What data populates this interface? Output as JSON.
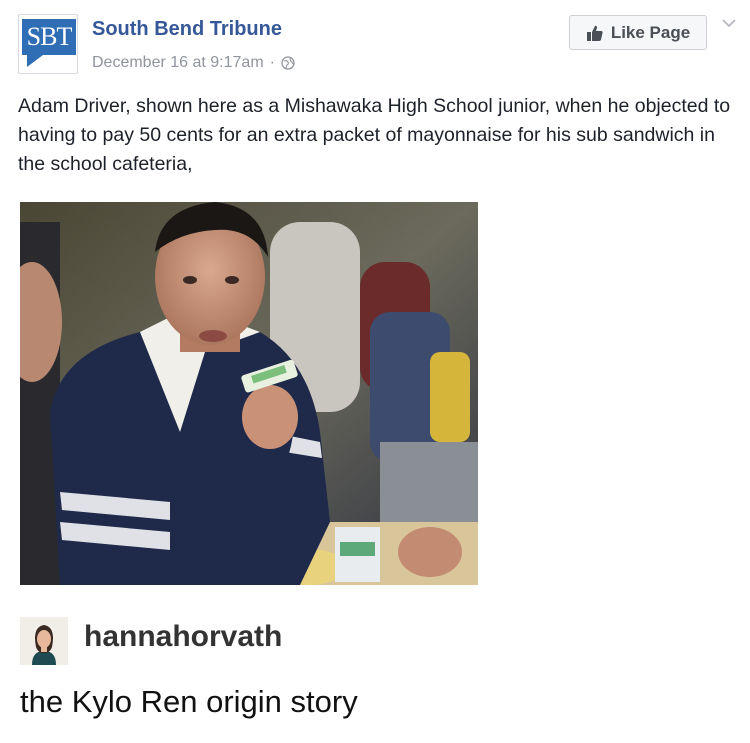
{
  "post": {
    "page_name": "South Bend Tribune",
    "logo_text": "SBT",
    "timestamp": "December 16 at 9:17am",
    "meta_separator": "·",
    "like_button_label": "Like Page",
    "body_text": "Adam Driver, shown here as a Mishawaka High School junior, when he objected to having to pay 50 cents for an extra packet of mayonnaise for his sub sandwich in the school cafeteria,",
    "photo_icon": "photo-student-eating",
    "globe_icon": "globe-icon",
    "like_icon": "thumbs-up-icon",
    "menu_icon": "chevron-down-icon"
  },
  "comment": {
    "username": "hannahorvath",
    "text": "the Kylo Ren origin story",
    "avatar_icon": "avatar-woman"
  },
  "colors": {
    "brand_blue": "#2f6db5",
    "page_name_blue": "#365899",
    "meta_gray": "#90949c",
    "button_bg": "#f6f7f9"
  }
}
